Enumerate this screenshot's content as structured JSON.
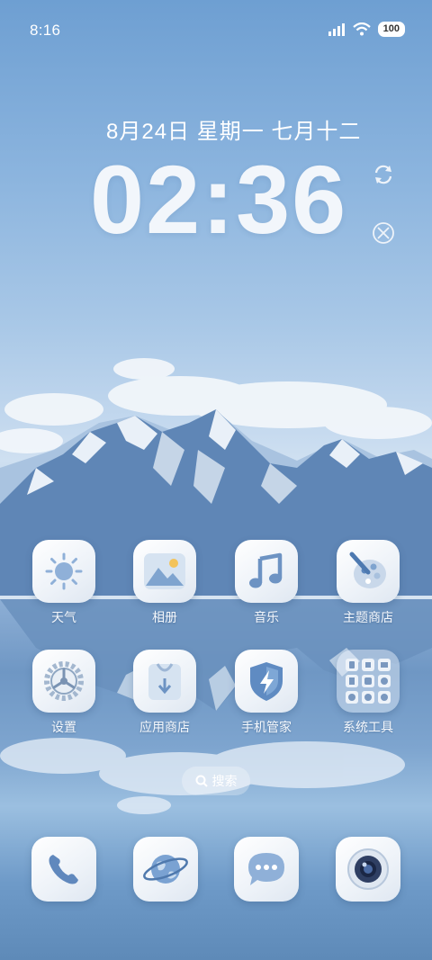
{
  "status_bar": {
    "time": "8:16",
    "battery": "100",
    "icons": [
      "signal-icon",
      "wifi-icon",
      "battery-icon"
    ]
  },
  "clock_widget": {
    "date": "8月24日 星期一 七月十二",
    "time": "02:36"
  },
  "apps": [
    {
      "label": "天气",
      "icon": "weather-sun-icon"
    },
    {
      "label": "相册",
      "icon": "gallery-icon"
    },
    {
      "label": "音乐",
      "icon": "music-note-icon"
    },
    {
      "label": "主题商店",
      "icon": "theme-palette-icon"
    },
    {
      "label": "设置",
      "icon": "settings-gear-icon"
    },
    {
      "label": "应用商店",
      "icon": "app-store-bag-icon"
    },
    {
      "label": "手机管家",
      "icon": "security-shield-icon"
    },
    {
      "label": "系统工具",
      "icon": "system-tools-folder-icon"
    }
  ],
  "search": {
    "label": "搜索"
  },
  "dock": [
    {
      "name": "phone",
      "icon": "phone-icon"
    },
    {
      "name": "browser",
      "icon": "globe-icon"
    },
    {
      "name": "messages",
      "icon": "message-icon"
    },
    {
      "name": "camera",
      "icon": "camera-icon"
    }
  ],
  "colors": {
    "icon_blue": "#5b86bd",
    "icon_light": "#eef3f9"
  }
}
